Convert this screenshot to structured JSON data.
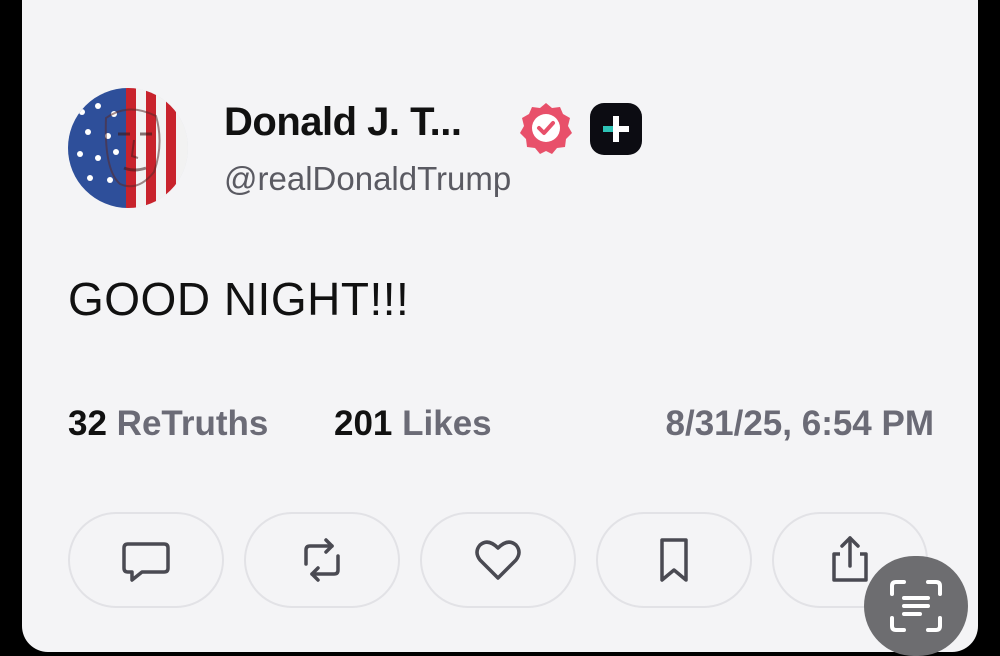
{
  "post": {
    "display_name": "Donald J. T...",
    "handle": "@realDonaldTrump",
    "text": "GOOD NIGHT!!!",
    "retruths_count": "32",
    "retruths_label": "ReTruths",
    "likes_count": "201",
    "likes_label": "Likes",
    "timestamp": "8/31/25, 6:54 PM"
  },
  "icons": {
    "avatar": "flag-face-avatar",
    "verified": "verified-badge-icon",
    "plus": "plus-badge-icon",
    "reply": "comment-icon",
    "retruth": "retruth-icon",
    "like": "heart-icon",
    "bookmark": "bookmark-icon",
    "share": "share-icon",
    "scan": "text-scan-icon"
  },
  "colors": {
    "card_bg": "#f4f4f6",
    "verified": "#e8506a",
    "plus_accent": "#2ec4b6",
    "muted_text": "#6b6b76"
  }
}
